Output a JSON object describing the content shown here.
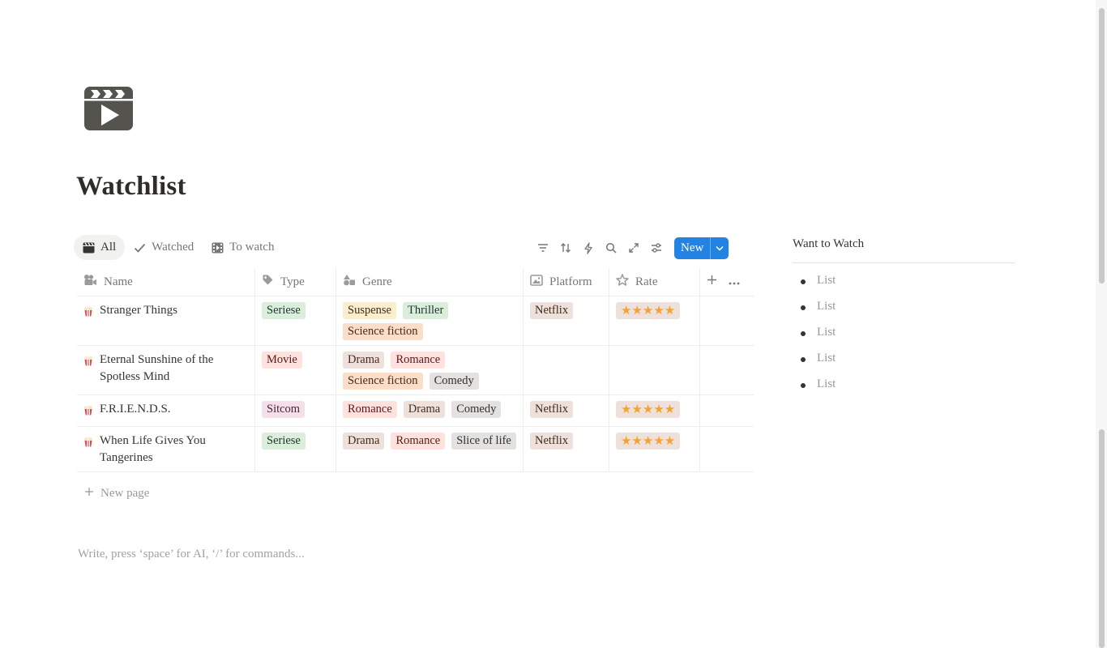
{
  "page": {
    "icon": "clapperboard-icon",
    "title": "Watchlist"
  },
  "views": [
    {
      "label": "All",
      "icon": "clapperboard-icon",
      "active": true
    },
    {
      "label": "Watched",
      "icon": "check-icon",
      "active": false
    },
    {
      "label": "To watch",
      "icon": "film-icon",
      "active": false
    }
  ],
  "toolbar": {
    "icons": [
      "filter-icon",
      "sort-icon",
      "automation-icon",
      "search-icon",
      "expand-icon",
      "settings-icon"
    ],
    "new_label": "New",
    "accent": "#2383e2"
  },
  "columns": [
    {
      "label": "Name",
      "icon": "video-camera-icon"
    },
    {
      "label": "Type",
      "icon": "tag-icon"
    },
    {
      "label": "Genre",
      "icon": "shapes-icon"
    },
    {
      "label": "Platform",
      "icon": "image-icon"
    },
    {
      "label": "Rate",
      "icon": "star-icon"
    }
  ],
  "rows": [
    {
      "name": "Stranger Things",
      "icon": "popcorn-icon",
      "type": {
        "label": "Seriese",
        "color": "green"
      },
      "genre": [
        {
          "label": "Suspense",
          "color": "yellow"
        },
        {
          "label": "Thriller",
          "color": "green"
        },
        {
          "label": "Science fiction",
          "color": "orange"
        }
      ],
      "platform": {
        "label": "Netflix",
        "color": "brown"
      },
      "rate": "★★★★★"
    },
    {
      "name": "Eternal Sunshine of the Spotless Mind",
      "icon": "popcorn-icon",
      "type": {
        "label": "Movie",
        "color": "red"
      },
      "genre": [
        {
          "label": "Drama",
          "color": "brown"
        },
        {
          "label": "Romance",
          "color": "red"
        },
        {
          "label": "Science fiction",
          "color": "orange"
        },
        {
          "label": "Comedy",
          "color": "gray"
        }
      ],
      "platform": null,
      "rate": null
    },
    {
      "name": "F.R.I.E.N.D.S.",
      "icon": "popcorn-icon",
      "type": {
        "label": "Sitcom",
        "color": "pink"
      },
      "genre": [
        {
          "label": "Romance",
          "color": "red"
        },
        {
          "label": "Drama",
          "color": "brown"
        },
        {
          "label": "Comedy",
          "color": "gray"
        }
      ],
      "platform": {
        "label": "Netflix",
        "color": "brown"
      },
      "rate": "★★★★★"
    },
    {
      "name": "When Life Gives You Tangerines",
      "icon": "popcorn-icon",
      "type": {
        "label": "Seriese",
        "color": "green"
      },
      "genre": [
        {
          "label": "Drama",
          "color": "brown"
        },
        {
          "label": "Romance",
          "color": "red"
        },
        {
          "label": "Slice of life",
          "color": "gray"
        }
      ],
      "platform": {
        "label": "Netflix",
        "color": "brown"
      },
      "rate": "★★★★★"
    }
  ],
  "table_footer": {
    "new_page": "New page"
  },
  "editor": {
    "placeholder": "Write, press ‘space’ for AI, ‘/’ for commands..."
  },
  "side_panel": {
    "title": "Want to Watch",
    "items": [
      "List",
      "List",
      "List",
      "List",
      "List"
    ]
  }
}
